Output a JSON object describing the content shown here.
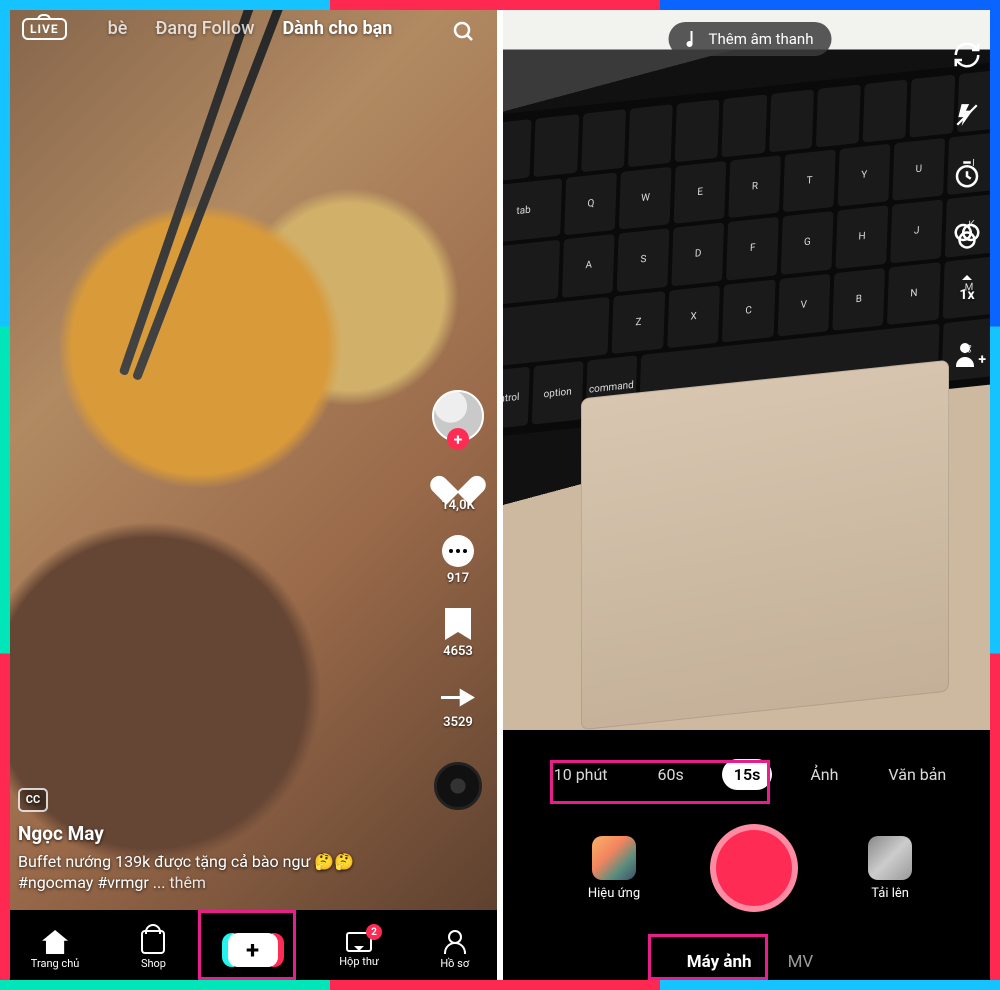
{
  "left": {
    "live_badge": "LIVE",
    "nav": {
      "friends": "bè",
      "following": "Đang Follow",
      "for_you": "Dành cho bạn"
    },
    "rail": {
      "likes": "14,0K",
      "comments": "917",
      "saves": "4653",
      "shares": "3529"
    },
    "cc": "CC",
    "author": "Ngọc May",
    "caption": "Buffet nướng 139k được tặng cả bào ngư 🤔🤔 #ngocmay #vrmgr ...",
    "more": "thêm",
    "bottom": {
      "home": "Trang chủ",
      "shop": "Shop",
      "inbox": "Hộp thư",
      "inbox_badge": "2",
      "profile": "Hồ sơ"
    }
  },
  "right": {
    "sound": "Thêm âm thanh",
    "speed": "1x",
    "durations": {
      "d10m": "10 phút",
      "d60s": "60s",
      "d15s": "15s",
      "photo": "Ảnh",
      "text": "Văn bản"
    },
    "effects": "Hiệu ứng",
    "upload": "Tải lên",
    "modes": {
      "camera": "Máy ảnh",
      "mv": "MV"
    }
  }
}
